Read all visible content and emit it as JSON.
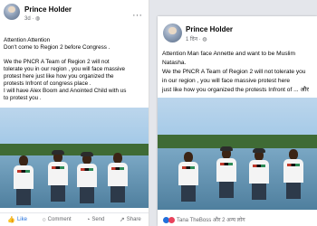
{
  "left_post": {
    "author": "Prince Holder",
    "time": "3d",
    "text_lines": [
      "Attention Attention",
      "Don't come to Region 2 before Congress .",
      "",
      "We the PNCR A Team of Region 2 will not",
      "tolerate you in our region ,  you will face massive",
      "protest here just like how you organized the",
      "protests Infront of congress place .",
      "I will have Alex Boom and Anointed Child with us",
      "to protest you ."
    ],
    "actions": {
      "like": "Like",
      "comment": "Comment",
      "send": "Send",
      "share": "Share"
    }
  },
  "right_post": {
    "author": "Prince Holder",
    "time": "1 दिन",
    "text_lines": [
      "Attention Man face Annette and want to be Muslim",
      "Natasha.",
      "We the PNCR A Team of Region 2 will not tolerate you",
      "in our region ,  you will face massive protest here",
      "just like how you organized the protests Infront of ... और"
    ],
    "reactions_text": "Tana TheBoss और 2 अन्य लोग"
  },
  "colors": {
    "like_blue": "#216fdb",
    "text": "#050505",
    "muted": "#65676b"
  },
  "icons": [
    "more-dots-icon",
    "globe-icon",
    "like-icon",
    "comment-icon",
    "send-icon",
    "share-icon",
    "like-reaction-icon",
    "love-reaction-icon"
  ]
}
